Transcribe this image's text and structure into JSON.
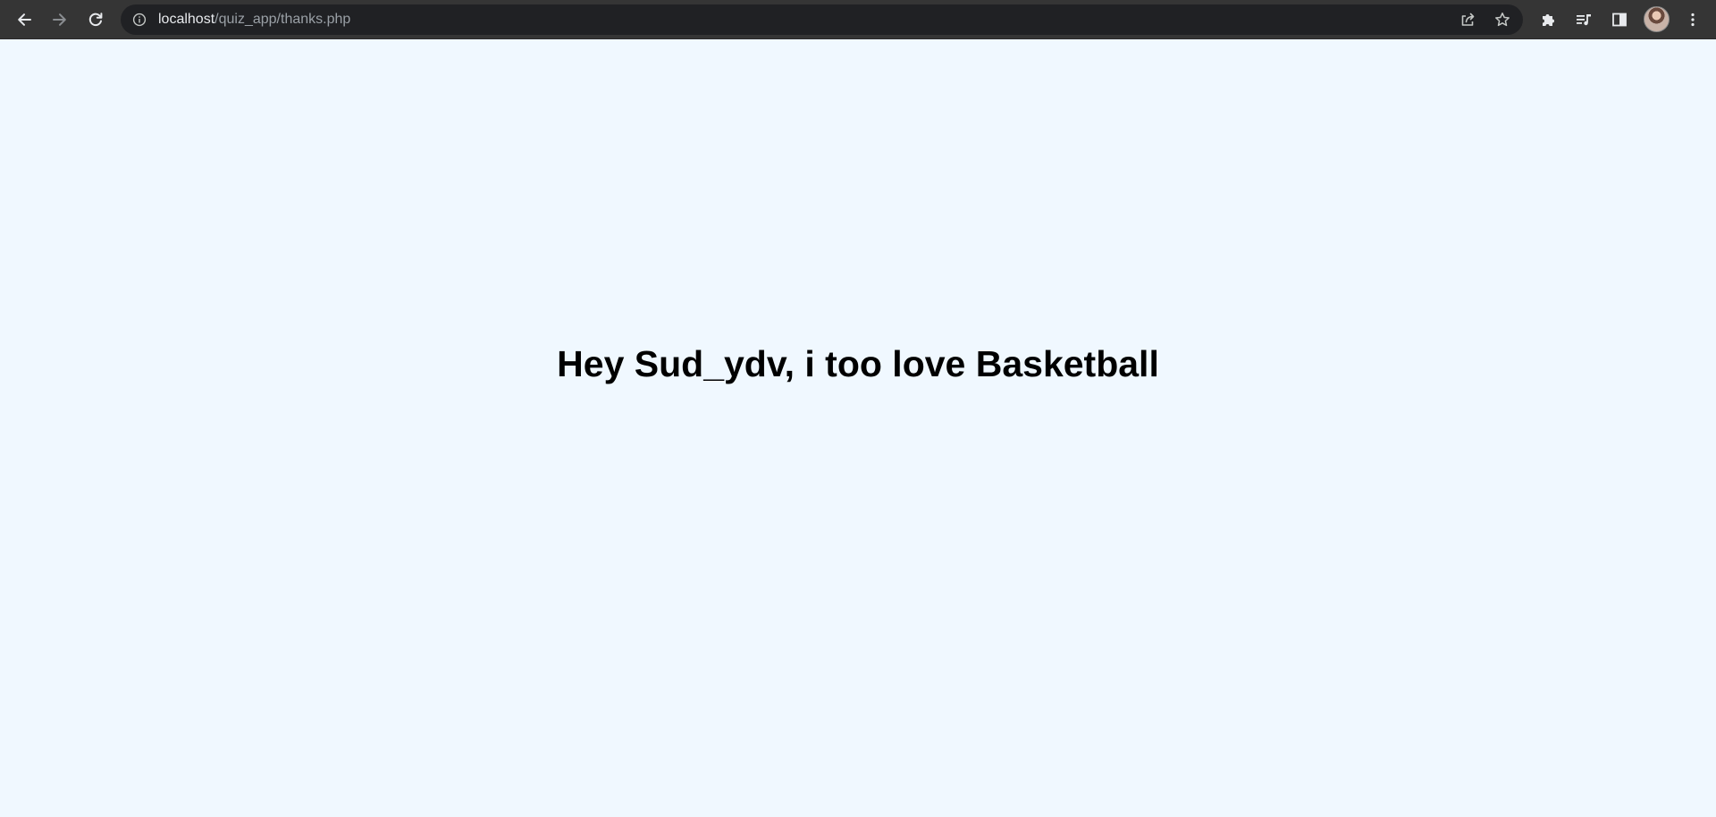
{
  "browser": {
    "url_host": "localhost",
    "url_path": "/quiz_app/thanks.php",
    "icons": {
      "back": "arrow-left-icon",
      "forward": "arrow-right-icon",
      "reload": "reload-icon",
      "site_info": "info-icon",
      "share": "share-icon",
      "bookmark": "star-icon",
      "extensions": "puzzle-icon",
      "media": "media-queue-icon",
      "side_panel": "side-panel-icon",
      "profile": "avatar",
      "menu": "kebab-menu-icon"
    }
  },
  "page": {
    "message": "Hey Sud_ydv, i too love Basketball",
    "background": "#f0f8ff"
  }
}
